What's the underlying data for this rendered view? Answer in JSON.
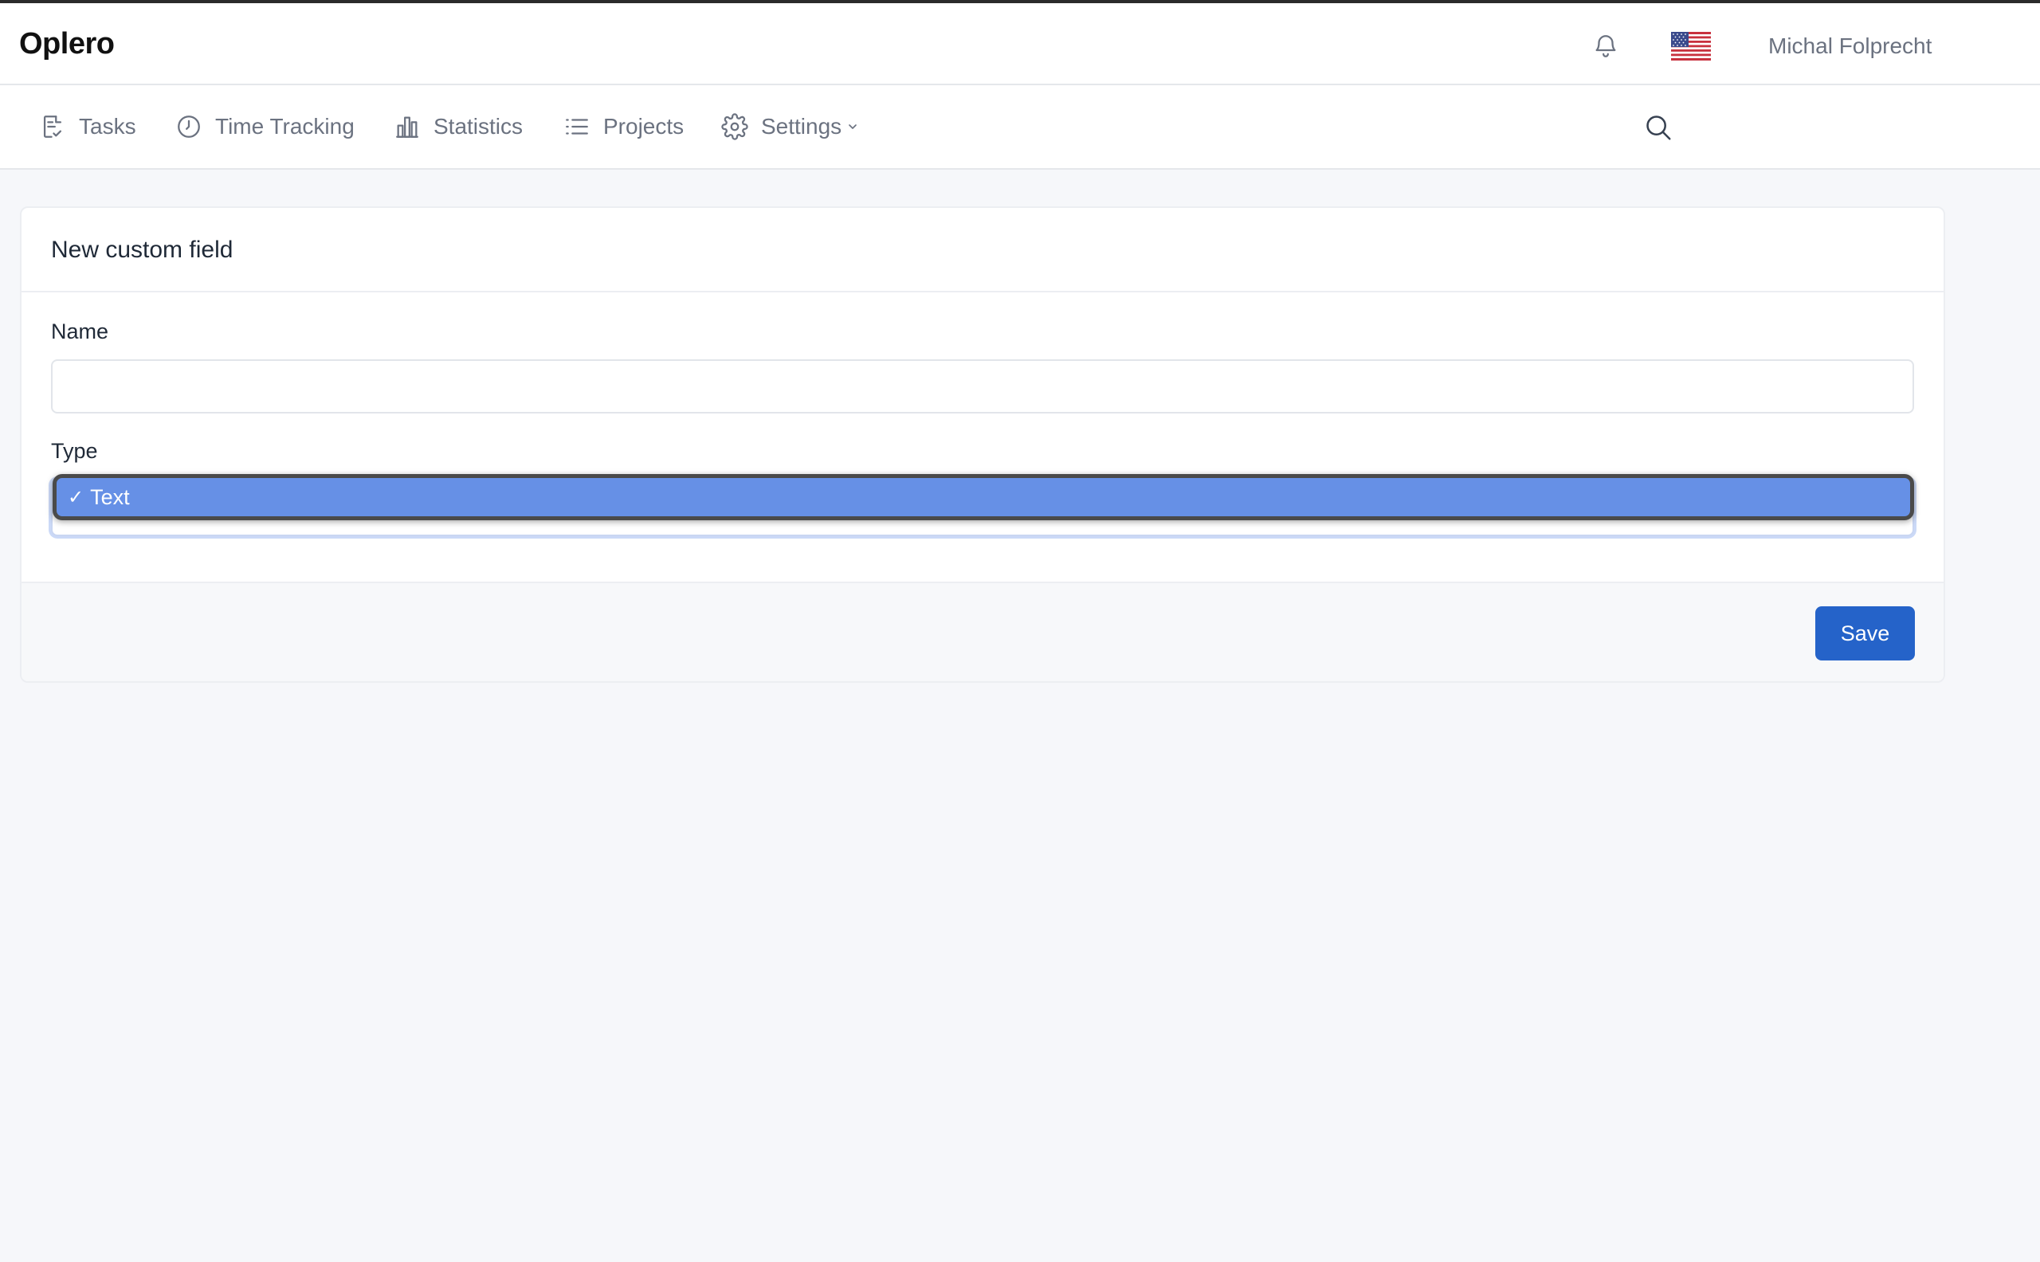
{
  "header": {
    "logo": "Oplero",
    "user_name": "Michal Folprecht",
    "icons": {
      "notifications": "bell-icon",
      "language": "us-flag-icon"
    }
  },
  "nav": {
    "items": [
      {
        "label": "Tasks",
        "icon": "task-list-icon"
      },
      {
        "label": "Time Tracking",
        "icon": "clock-icon"
      },
      {
        "label": "Statistics",
        "icon": "bar-chart-icon"
      },
      {
        "label": "Projects",
        "icon": "list-icon"
      },
      {
        "label": "Settings",
        "icon": "gear-icon"
      }
    ],
    "search_icon": "search-icon"
  },
  "form": {
    "title": "New custom field",
    "name_label": "Name",
    "name_value": "",
    "type_label": "Type",
    "type_selected": "Text",
    "type_checkmark": "✓",
    "save_label": "Save"
  },
  "colors": {
    "accent": "#2563c9",
    "dropdown_highlight": "#6690e6",
    "background": "#f6f7fa"
  }
}
